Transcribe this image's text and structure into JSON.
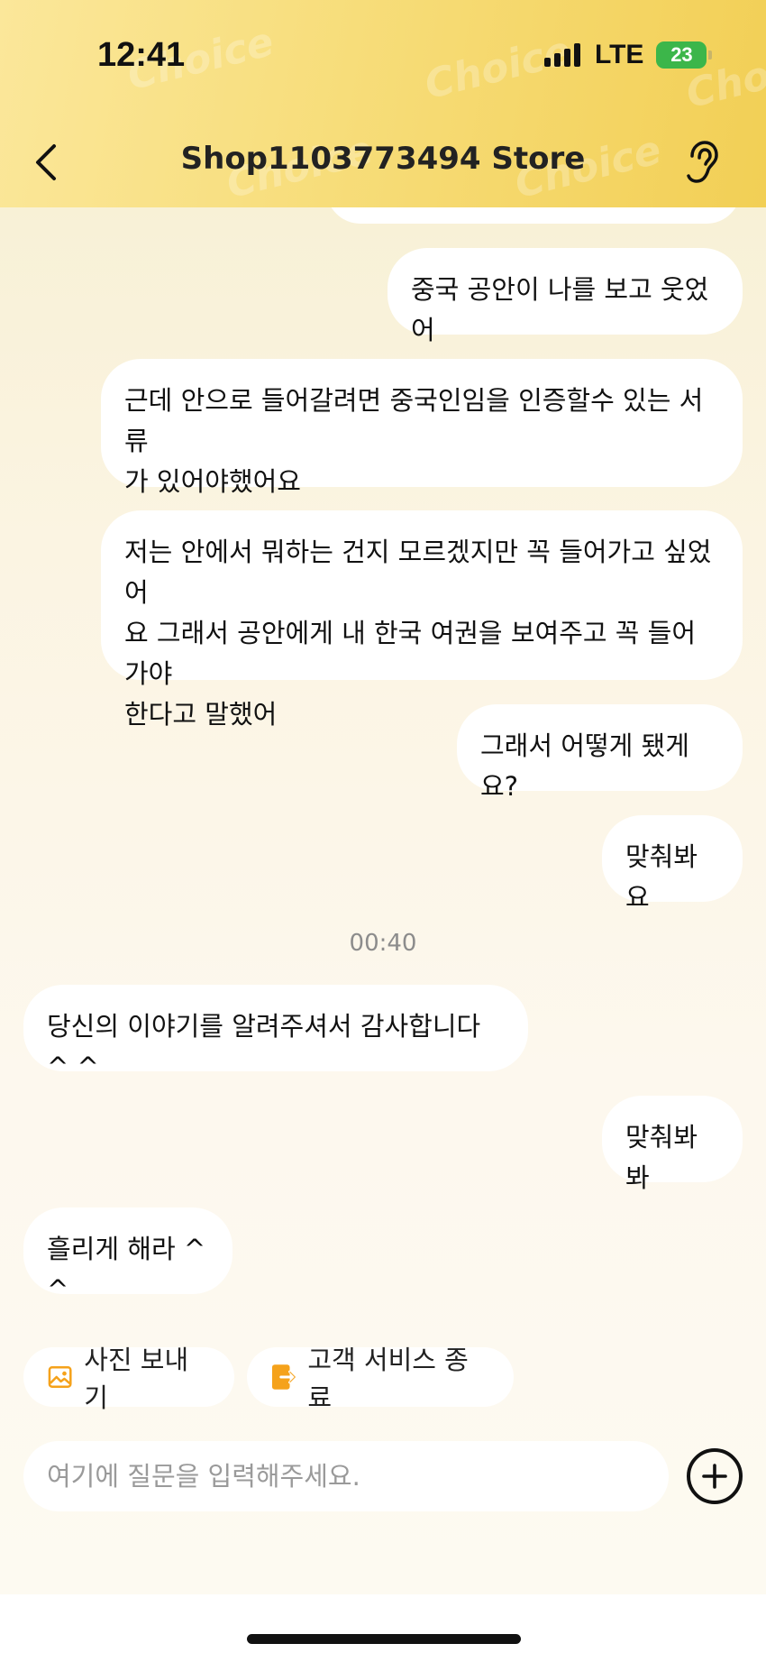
{
  "status_bar": {
    "time": "12:41",
    "network": "LTE",
    "battery": "23"
  },
  "header": {
    "title": "Shop1103773494 Store",
    "watermark": "Choice"
  },
  "messages": [
    {
      "side": "right",
      "text": "중국 공안이 나를 보고 웃었어"
    },
    {
      "side": "right",
      "lines": [
        "근데 안으로 들어갈려면 중국인임을 인증할수 있는 서류",
        "가 있어야했어요"
      ]
    },
    {
      "side": "right",
      "lines": [
        "저는 안에서 뭐하는 건지 모르겠지만 꼭 들어가고 싶었어",
        "요 그래서 공안에게 내 한국 여권을 보여주고 꼭 들어가야",
        "한다고 말했어"
      ]
    },
    {
      "side": "right",
      "text": "그래서 어떻게 됐게요?"
    },
    {
      "side": "right",
      "text": "맞춰봐요"
    },
    {
      "type": "timestamp",
      "text": "00:40"
    },
    {
      "side": "left",
      "text": "당신의 이야기를 알려주셔서 감사합니다 ^ ^"
    },
    {
      "side": "right",
      "text": "맞춰봐봐"
    },
    {
      "side": "left",
      "text": "흘리게 해라 ^ ^"
    }
  ],
  "quick_actions": {
    "send_photo": "사진 보내기",
    "end_service": "고객 서비스 종료"
  },
  "input": {
    "placeholder": "여기에 질문을 입력해주세요.",
    "value": ""
  },
  "icons": {
    "back": "chevron-left-icon",
    "voice": "ear-icon",
    "photo": "image-icon",
    "exit": "exit-icon",
    "plus": "plus-icon"
  },
  "colors": {
    "header_start": "#fbe79a",
    "header_end": "#f2cf55",
    "accent_orange": "#f5a21b",
    "battery_green": "#3cb64a"
  }
}
